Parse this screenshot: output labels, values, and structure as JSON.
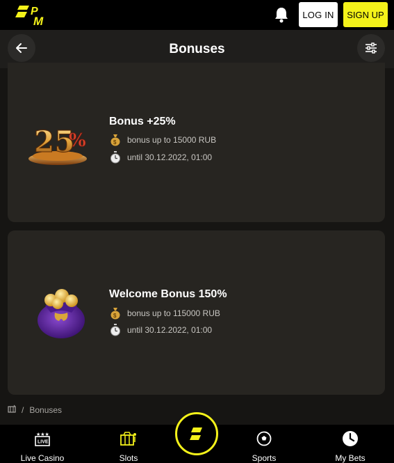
{
  "topbar": {
    "logo_icon": "pm-logo-icon",
    "bell_icon": "bell-icon",
    "login_label": "LOG IN",
    "signup_label": "SIGN UP",
    "accent_color": "#f4f21a"
  },
  "header": {
    "title": "Bonuses",
    "back_icon": "arrow-left-icon",
    "filter_icon": "sliders-icon"
  },
  "bonuses": [
    {
      "title": "Bonus +25%",
      "image_icon": "percent-25-trophy-icon",
      "amount": "bonus up to 15000 RUB",
      "until": "until 30.12.2022, 01:00"
    },
    {
      "title": "Welcome Bonus 150%",
      "image_icon": "gold-bag-icon",
      "amount": "bonus up to 115000 RUB",
      "until": "until 30.12.2022, 01:00"
    }
  ],
  "breadcrumb": {
    "home_icon": "casino-home-icon",
    "separator": "/",
    "current": "Bonuses"
  },
  "bottomnav": {
    "items": [
      {
        "label": "Live Casino",
        "icon": "live-icon",
        "badge": "LIVE"
      },
      {
        "label": "Slots",
        "icon": "slots-icon"
      },
      {
        "label": "Sports",
        "icon": "soccer-ball-icon"
      },
      {
        "label": "My Bets",
        "icon": "clock-icon"
      }
    ],
    "center_icon": "pm-center-logo-icon"
  }
}
